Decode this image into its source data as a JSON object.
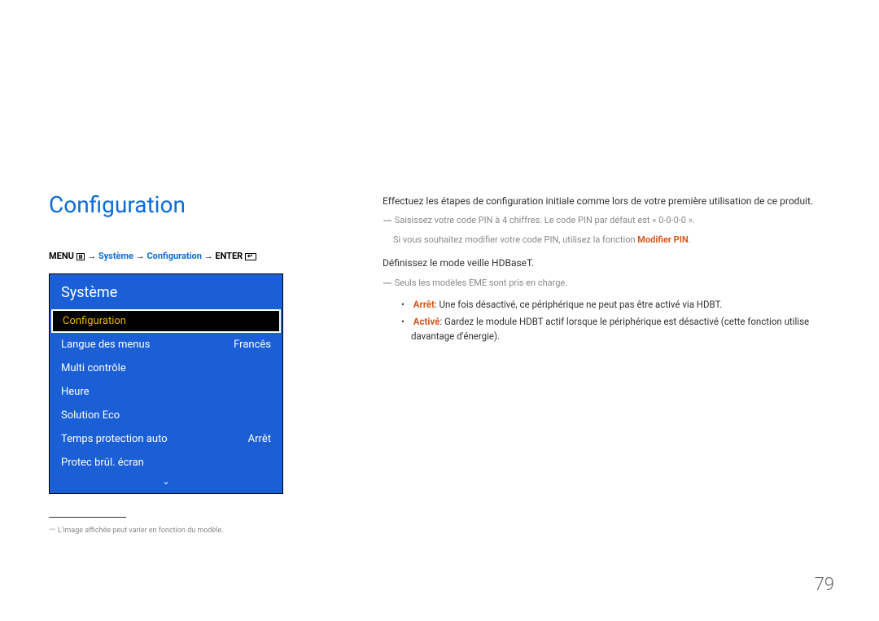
{
  "page_title": "Configuration",
  "breadcrumb": {
    "menu_label": "MENU",
    "path_system": "Système",
    "path_config": "Configuration",
    "enter_label": "ENTER",
    "arrow": "→"
  },
  "menu": {
    "header": "Système",
    "items": [
      {
        "label": "Configuration",
        "value": "",
        "selected": true
      },
      {
        "label": "Langue des menus",
        "value": "Francês",
        "selected": false
      },
      {
        "label": "Multi contrôle",
        "value": "",
        "selected": false
      },
      {
        "label": "Heure",
        "value": "",
        "selected": false
      },
      {
        "label": "Solution Eco",
        "value": "",
        "selected": false
      },
      {
        "label": "Temps protection auto",
        "value": "Arrêt",
        "selected": false
      },
      {
        "label": "Protec brûl. écran",
        "value": "",
        "selected": false
      }
    ],
    "chevron": "⌄"
  },
  "footnote": "L'image affichée peut varier en fonction du modèle.",
  "content": {
    "p1": "Effectuez les étapes de configuration initiale comme lors de votre première utilisation de ce produit.",
    "n1": "Saisissez votre code PIN à 4 chiffres. Le code PIN par défaut est « 0-0-0-0 ».",
    "n1b_pre": "Si vous souhaitez modifier votre code PIN, utilisez la fonction ",
    "n1b_hl": "Modifier PIN",
    "n1b_post": ".",
    "p2": "Définissez le mode veille HDBaseT.",
    "n2": "Seuls les modèles EME sont pris en charge.",
    "b1_hl": "Arrêt",
    "b1_text": ": Une fois désactivé, ce périphérique ne peut pas être activé via HDBT.",
    "b2_hl": "Activé",
    "b2_text": ": Gardez le module HDBT actif lorsque le périphérique est désactivé (cette fonction utilise davantage d'énergie).",
    "dash": "―"
  },
  "page_number": "79"
}
